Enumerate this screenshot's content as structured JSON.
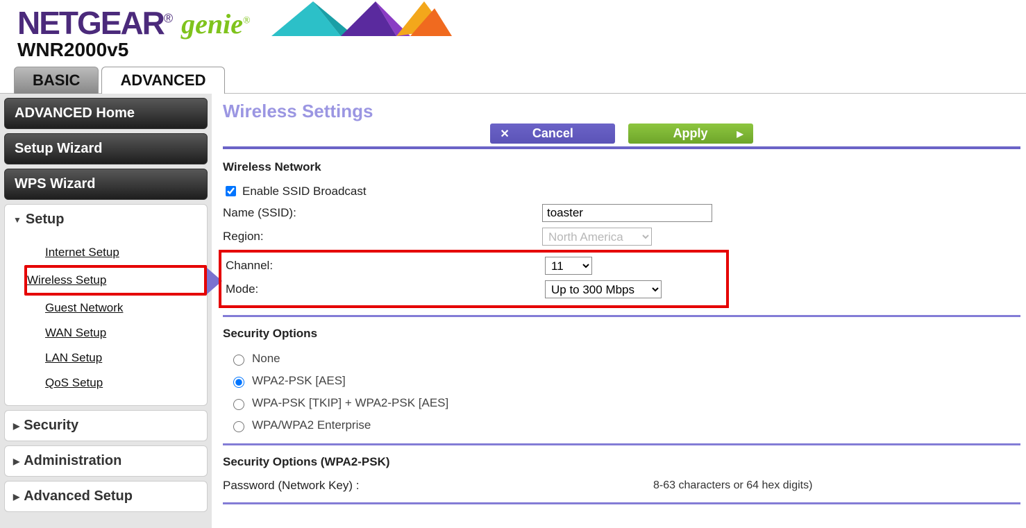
{
  "header": {
    "brand": "NETGEAR",
    "product": "genie",
    "model": "WNR2000v5"
  },
  "tabs": {
    "basic": "BASIC",
    "advanced": "ADVANCED"
  },
  "sidebar": {
    "advanced_home": "ADVANCED Home",
    "setup_wizard": "Setup Wizard",
    "wps_wizard": "WPS Wizard",
    "setup": {
      "title": "Setup",
      "items": {
        "internet": "Internet Setup",
        "wireless": "Wireless Setup",
        "guest": "Guest Network",
        "wan": "WAN Setup",
        "lan": "LAN Setup",
        "qos": "QoS Setup"
      }
    },
    "security": "Security",
    "administration": "Administration",
    "advanced_setup": "Advanced Setup"
  },
  "page": {
    "title": "Wireless Settings",
    "cancel": "Cancel",
    "apply": "Apply"
  },
  "wireless": {
    "section_title": "Wireless Network",
    "enable_ssid_label": "Enable SSID Broadcast",
    "enable_ssid_checked": true,
    "name_label": "Name (SSID):",
    "name_value": "toaster",
    "region_label": "Region:",
    "region_value": "North America",
    "channel_label": "Channel:",
    "channel_value": "11",
    "mode_label": "Mode:",
    "mode_value": "Up to 300 Mbps"
  },
  "security": {
    "section_title": "Security Options",
    "options": {
      "none": "None",
      "wpa2psk": "WPA2-PSK [AES]",
      "wpapsk_mixed": "WPA-PSK [TKIP] + WPA2-PSK [AES]",
      "enterprise": "WPA/WPA2 Enterprise"
    },
    "selected": "wpa2psk"
  },
  "psk": {
    "section_title": "Security Options (WPA2-PSK)",
    "password_label": "Password (Network Key) :",
    "hint": "8-63 characters or 64 hex digits)"
  }
}
